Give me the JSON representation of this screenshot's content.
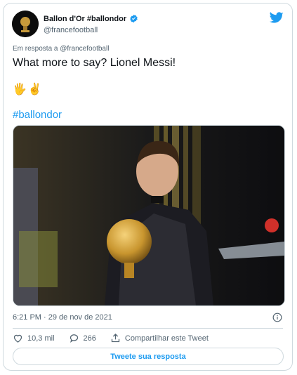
{
  "tweet": {
    "author_name": "Ballon d'Or #ballondor",
    "handle": "@francefootball",
    "reply_to": "Em resposta a @francefootball",
    "text": "What more to say? Lionel Messi!",
    "emoji": "🖐✌",
    "hashtag": "#ballondor",
    "timestamp": "6:21 PM · 29 de nov de 2021"
  },
  "actions": {
    "likes": "10,3 mil",
    "replies": "266",
    "share_label": "Compartilhar este Tweet",
    "reply_button_label": "Tweete sua resposta"
  },
  "colors": {
    "accent": "#1d9bf0",
    "secondary_text": "#536471",
    "border": "#cfd9de"
  },
  "icons": [
    "twitter-bird-icon",
    "verified-badge-icon",
    "info-icon",
    "heart-icon",
    "reply-icon",
    "share-icon"
  ]
}
